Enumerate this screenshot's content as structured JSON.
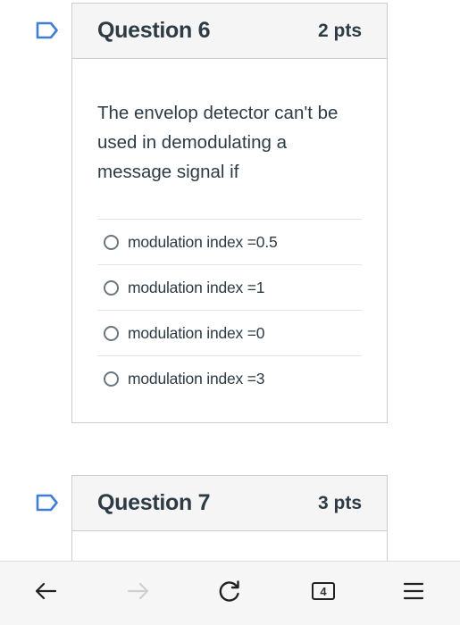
{
  "questions": [
    {
      "title": "Question 6",
      "points": "2 pts",
      "text": "The envelop detector can't be used in demodulating a message signal if",
      "answers": [
        {
          "label": "modulation index =0.5",
          "selected": false
        },
        {
          "label": "modulation index =1",
          "selected": false
        },
        {
          "label": "modulation index =0",
          "selected": false
        },
        {
          "label": "modulation index =3",
          "selected": false
        }
      ]
    },
    {
      "title": "Question 7",
      "points": "3 pts"
    }
  ],
  "toolbar": {
    "back_icon": "arrow-left-icon",
    "forward_icon": "arrow-right-icon",
    "forward_enabled": false,
    "reload_icon": "reload-icon",
    "tab_count": "4",
    "menu_icon": "hamburger-menu-icon"
  },
  "colors": {
    "flag": "#3f7dd6",
    "header_bg": "#f5f5f5",
    "border": "#c7cdd1",
    "text": "#2d3b45",
    "toolbar_bg": "#f6f6f6"
  }
}
